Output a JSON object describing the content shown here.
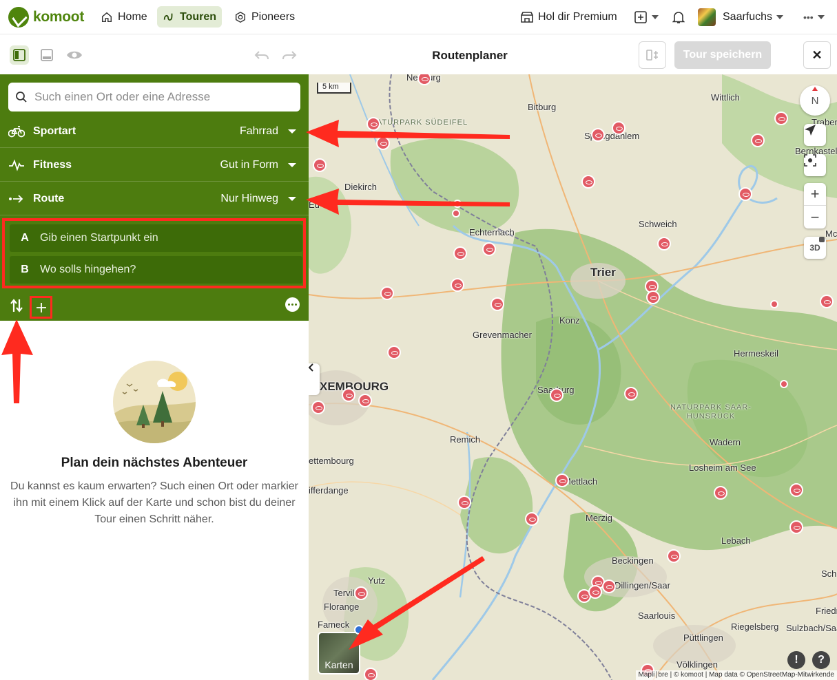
{
  "nav": {
    "brand": "komoot",
    "items": [
      {
        "label": "Home"
      },
      {
        "label": "Touren"
      },
      {
        "label": "Pioneers"
      }
    ],
    "premium": "Hol dir Premium",
    "user": "Saarfuchs",
    "more": "•••"
  },
  "toolbar": {
    "title": "Routenplaner",
    "save_label": "Tour speichern",
    "close": "✕"
  },
  "planner": {
    "search_placeholder": "Such einen Ort oder eine Adresse",
    "options": [
      {
        "label": "Sportart",
        "value": "Fahrrad"
      },
      {
        "label": "Fitness",
        "value": "Gut in Form"
      },
      {
        "label": "Route",
        "value": "Nur Hinweg"
      }
    ],
    "waypoints": [
      {
        "letter": "A",
        "placeholder": "Gib einen Startpunkt ein"
      },
      {
        "letter": "B",
        "placeholder": "Wo solls hingehen?"
      }
    ],
    "empty_title": "Plan dein nächstes Abenteuer",
    "empty_text": "Du kannst es kaum erwarten? Such einen Ort oder markier ihn mit einem Klick auf der Karte und schon bist du deiner Tour einen Schritt näher."
  },
  "map": {
    "scale": "5 km",
    "compass": "N",
    "three_d": "3D",
    "layers": "Karten",
    "attribution": "Mapli∣bre | © komoot | Map data © OpenStreetMap-Mitwirkende",
    "labels": [
      "Bitburg",
      "Wittlich",
      "Diekirch",
      "Echternach",
      "Schweich",
      "Trier",
      "Konz",
      "Grevenmacher",
      "Hermeskeil",
      "XEMBOURG",
      "Saarburg",
      "Remich",
      "Wadern",
      "Losheim am See",
      "Mettlach",
      "Merzig",
      "Lebach",
      "Beckingen",
      "Dillingen/Saar",
      "Saarlouis",
      "Riegelsberg",
      "Sulzbach/Saa",
      "Püttlingen",
      "Völklingen",
      "Tervil",
      "Florange",
      "Fameck",
      "Yutz",
      "ettembourg",
      "ifferdange",
      "Bernkastel-K",
      "Traben",
      "Spangdahlem",
      "Friedrich",
      "Sch",
      "Mc",
      "Ne",
      "Neuburg",
      "Ed"
    ],
    "region_labels": [
      "NATURPARK SÜDEIFEL",
      "NATURPARK SAAR-HUNSRÜCK"
    ]
  },
  "colors": {
    "brand": "#4f850d",
    "panel": "#4d7c0f",
    "annotation": "#ff2a1f"
  }
}
